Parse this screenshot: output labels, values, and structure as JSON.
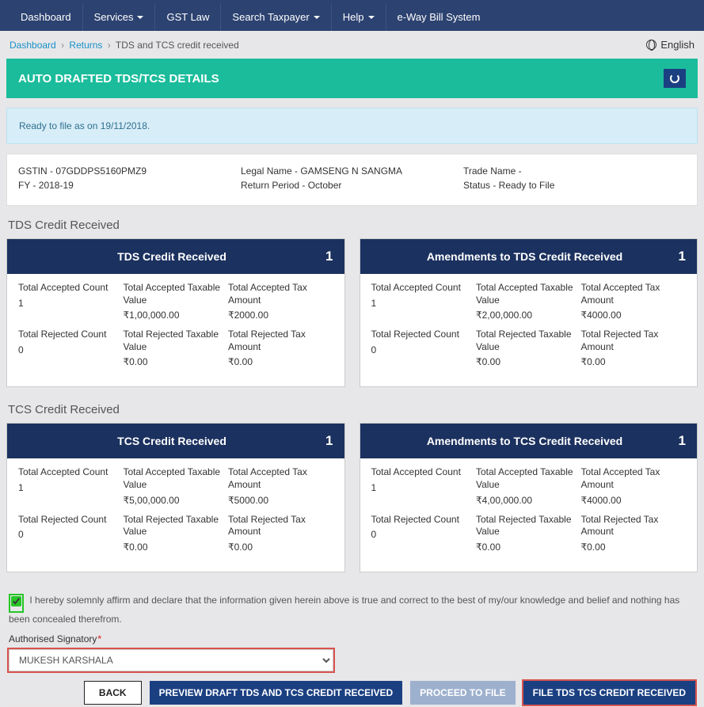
{
  "nav": {
    "items": [
      "Dashboard",
      "Services",
      "GST Law",
      "Search Taxpayer",
      "Help",
      "e-Way Bill System"
    ],
    "dropdown": [
      false,
      true,
      false,
      true,
      true,
      false
    ]
  },
  "breadcrumb": {
    "items": [
      "Dashboard",
      "Returns",
      "TDS and TCS credit received"
    ]
  },
  "language": "English",
  "banner": {
    "title": "AUTO DRAFTED TDS/TCS DETAILS"
  },
  "alert": {
    "text": "Ready to file as on 19/11/2018."
  },
  "info": {
    "gstin": "GSTIN - 07GDDPS5160PMZ9",
    "fy": "FY - 2018-19",
    "legal_name": "Legal Name - GAMSENG N SANGMA",
    "return_period": "Return Period - October",
    "trade_name": "Trade Name -",
    "status": "Status - Ready to File"
  },
  "sections": {
    "tds": {
      "heading": "TDS Credit Received",
      "tiles": [
        {
          "title": "TDS Credit Received",
          "count": "1",
          "metrics": {
            "accepted_count_label": "Total Accepted Count",
            "accepted_count_value": "1",
            "accepted_taxable_label": "Total Accepted Taxable Value",
            "accepted_taxable_value": "₹1,00,000.00",
            "accepted_tax_label": "Total Accepted Tax Amount",
            "accepted_tax_value": "₹2000.00",
            "rejected_count_label": "Total Rejected Count",
            "rejected_count_value": "0",
            "rejected_taxable_label": "Total Rejected Taxable Value",
            "rejected_taxable_value": "₹0.00",
            "rejected_tax_label": "Total Rejected Tax Amount",
            "rejected_tax_value": "₹0.00"
          }
        },
        {
          "title": "Amendments to TDS Credit Received",
          "count": "1",
          "metrics": {
            "accepted_count_label": "Total Accepted Count",
            "accepted_count_value": "1",
            "accepted_taxable_label": "Total Accepted Taxable Value",
            "accepted_taxable_value": "₹2,00,000.00",
            "accepted_tax_label": "Total Accepted Tax Amount",
            "accepted_tax_value": "₹4000.00",
            "rejected_count_label": "Total Rejected Count",
            "rejected_count_value": "0",
            "rejected_taxable_label": "Total Rejected Taxable Value",
            "rejected_taxable_value": "₹0.00",
            "rejected_tax_label": "Total Rejected Tax Amount",
            "rejected_tax_value": "₹0.00"
          }
        }
      ]
    },
    "tcs": {
      "heading": "TCS Credit Received",
      "tiles": [
        {
          "title": "TCS Credit Received",
          "count": "1",
          "metrics": {
            "accepted_count_label": "Total Accepted Count",
            "accepted_count_value": "1",
            "accepted_taxable_label": "Total Accepted Taxable Value",
            "accepted_taxable_value": "₹5,00,000.00",
            "accepted_tax_label": "Total Accepted Tax Amount",
            "accepted_tax_value": "₹5000.00",
            "rejected_count_label": "Total Rejected Count",
            "rejected_count_value": "0",
            "rejected_taxable_label": "Total Rejected Taxable Value",
            "rejected_taxable_value": "₹0.00",
            "rejected_tax_label": "Total Rejected Tax Amount",
            "rejected_tax_value": "₹0.00"
          }
        },
        {
          "title": "Amendments to TCS Credit Received",
          "count": "1",
          "metrics": {
            "accepted_count_label": "Total Accepted Count",
            "accepted_count_value": "1",
            "accepted_taxable_label": "Total Accepted Taxable Value",
            "accepted_taxable_value": "₹4,00,000.00",
            "accepted_tax_label": "Total Accepted Tax Amount",
            "accepted_tax_value": "₹4000.00",
            "rejected_count_label": "Total Rejected Count",
            "rejected_count_value": "0",
            "rejected_taxable_label": "Total Rejected Taxable Value",
            "rejected_taxable_value": "₹0.00",
            "rejected_tax_label": "Total Rejected Tax Amount",
            "rejected_tax_value": "₹0.00"
          }
        }
      ]
    }
  },
  "affirmation": {
    "text": "I hereby solemnly affirm and declare that the information given herein above is true and correct to the best of my/our knowledge and belief and nothing has been concealed therefrom.",
    "label": "Authorised Signatory",
    "selected": "MUKESH KARSHALA"
  },
  "buttons": {
    "back": "BACK",
    "preview": "PREVIEW DRAFT TDS AND TCS CREDIT RECEIVED",
    "proceed": "PROCEED TO FILE",
    "file": "FILE TDS TCS CREDIT RECEIVED"
  }
}
